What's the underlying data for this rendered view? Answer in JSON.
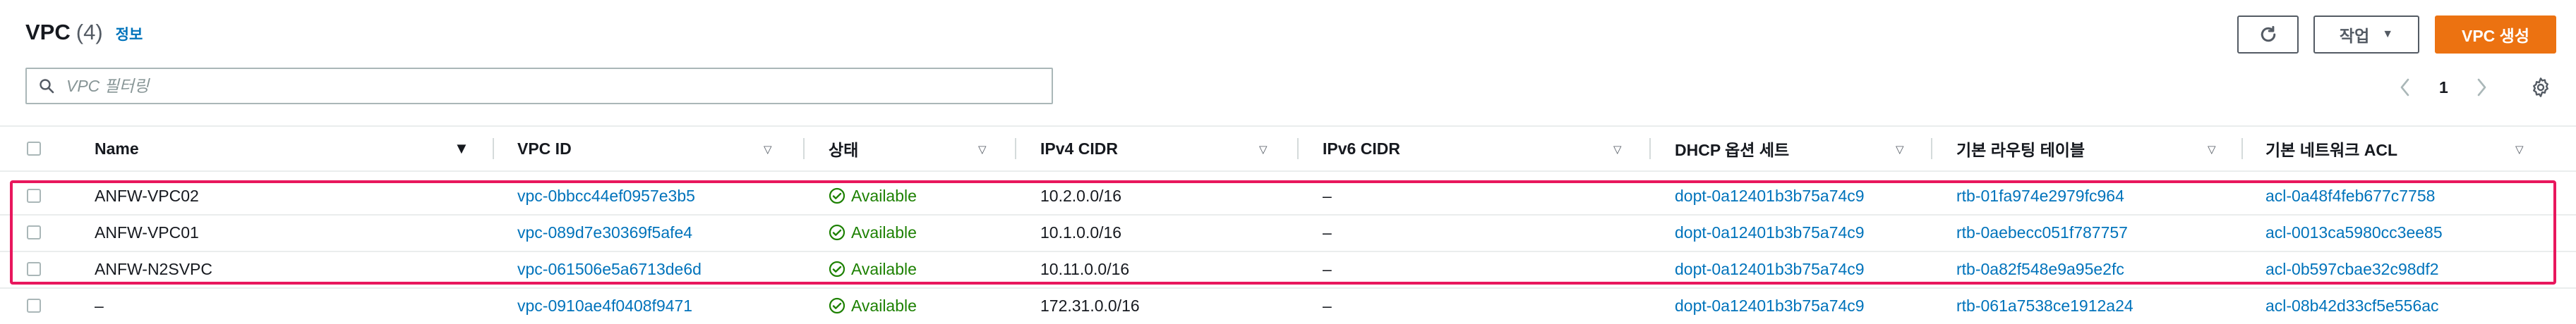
{
  "header": {
    "title": "VPC",
    "count": "(4)",
    "info_link": "정보",
    "refresh_icon": "refresh-icon",
    "actions_label": "작업",
    "create_label": "VPC 생성"
  },
  "search": {
    "placeholder": "VPC 필터링",
    "value": ""
  },
  "pagination": {
    "current_page": "1"
  },
  "table": {
    "columns": [
      "Name",
      "VPC ID",
      "상태",
      "IPv4 CIDR",
      "IPv6 CIDR",
      "DHCP 옵션 세트",
      "기본 라우팅 테이블",
      "기본 네트워크 ACL"
    ],
    "rows": [
      {
        "name": "ANFW-VPC02",
        "vpc_id": "vpc-0bbcc44ef0957e3b5",
        "status": "Available",
        "ipv4": "10.2.0.0/16",
        "ipv6": "–",
        "dhcp": "dopt-0a12401b3b75a74c9",
        "route_table": "rtb-01fa974e2979fc964",
        "acl": "acl-0a48f4feb677c7758"
      },
      {
        "name": "ANFW-VPC01",
        "vpc_id": "vpc-089d7e30369f5afe4",
        "status": "Available",
        "ipv4": "10.1.0.0/16",
        "ipv6": "–",
        "dhcp": "dopt-0a12401b3b75a74c9",
        "route_table": "rtb-0aebecc051f787757",
        "acl": "acl-0013ca5980cc3ee85"
      },
      {
        "name": "ANFW-N2SVPC",
        "vpc_id": "vpc-061506e5a6713de6d",
        "status": "Available",
        "ipv4": "10.11.0.0/16",
        "ipv6": "–",
        "dhcp": "dopt-0a12401b3b75a74c9",
        "route_table": "rtb-0a82f548e9a95e2fc",
        "acl": "acl-0b597cbae32c98df2"
      },
      {
        "name": "–",
        "vpc_id": "vpc-0910ae4f0408f9471",
        "status": "Available",
        "ipv4": "172.31.0.0/16",
        "ipv6": "–",
        "dhcp": "dopt-0a12401b3b75a74c9",
        "route_table": "rtb-061a7538ce1912a24",
        "acl": "acl-08b42d33cf5e556ac"
      }
    ]
  },
  "colors": {
    "link": "#0073bb",
    "status_available": "#1d8102",
    "primary_button": "#ec7211",
    "highlight_border": "#e8175d"
  }
}
